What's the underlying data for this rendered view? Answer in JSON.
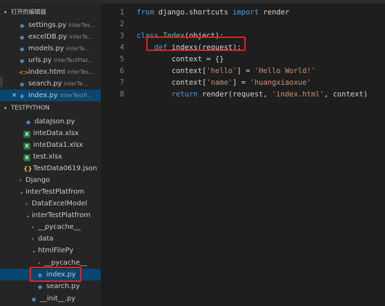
{
  "explorer": {
    "open_editors": {
      "title": "打开的编辑器",
      "items": [
        {
          "name": "settings.py",
          "desc": "interTes...",
          "icon": "python-file-icon"
        },
        {
          "name": "excelDB.py",
          "desc": "interTe...",
          "icon": "python-file-icon"
        },
        {
          "name": "models.py",
          "desc": "interTe...",
          "icon": "python-file-icon"
        },
        {
          "name": "urls.py",
          "desc": "interTestPlat...",
          "icon": "python-file-icon"
        },
        {
          "name": "index.html",
          "desc": "interTes...",
          "icon": "html-file-icon"
        },
        {
          "name": "search.py",
          "desc": "interTe...",
          "icon": "python-file-icon"
        },
        {
          "name": "index.py",
          "desc": "interTestP...",
          "icon": "python-file-icon",
          "selected": true
        }
      ]
    },
    "workspace": {
      "title": "TESTPYTHON",
      "items": [
        {
          "name": "dataJson.py",
          "icon": "python-file-icon"
        },
        {
          "name": "inteData.xlsx",
          "icon": "excel-file-icon"
        },
        {
          "name": "inteData1.xlsx",
          "icon": "excel-file-icon"
        },
        {
          "name": "test.xlsx",
          "icon": "excel-file-icon"
        },
        {
          "name": "TestData0619.json",
          "icon": "json-file-icon"
        },
        {
          "name": "Django",
          "icon": "folder-collapsed"
        },
        {
          "name": "interTestPlatfrom",
          "icon": "folder-expanded"
        },
        {
          "name": "DataExcelModel",
          "icon": "folder-collapsed"
        },
        {
          "name": "interTestPlatfrom",
          "icon": "folder-expanded"
        },
        {
          "name": "__pycache__",
          "icon": "folder-collapsed"
        },
        {
          "name": "data",
          "icon": "folder-collapsed"
        },
        {
          "name": "htmlFilePy",
          "icon": "folder-expanded"
        },
        {
          "name": "__pycache__",
          "icon": "folder-collapsed"
        },
        {
          "name": "index.py",
          "icon": "python-file-icon",
          "selected": true
        },
        {
          "name": "search.py",
          "icon": "python-file-icon"
        },
        {
          "name": "__init__.py",
          "icon": "python-file-icon"
        }
      ]
    }
  },
  "editor": {
    "line_numbers": [
      "1",
      "2",
      "3",
      "4",
      "5",
      "6",
      "7",
      "8"
    ],
    "code": {
      "l1_from": "from",
      "l1_mod": " django.shortcuts ",
      "l1_import": "import",
      "l1_name": " render",
      "l3_class": "class",
      "l3_name": "Index",
      "l3_paren": "(object):",
      "l4_def": "def",
      "l4_name": " indexs(request):",
      "l5": "        context = {}",
      "l6_pre": "        context[",
      "l6_key": "'hello'",
      "l6_mid": "] = ",
      "l6_val": "'Hello World!'",
      "l7_pre": "        context[",
      "l7_key": "'name'",
      "l7_mid": "] = ",
      "l7_val": "'huangxiaoxue'",
      "l8_return": "return",
      "l8_pre": " render(request, ",
      "l8_str": "'index.html'",
      "l8_post": ", context)"
    }
  },
  "colors": {
    "highlight": "#e0261c",
    "selection": "#094771"
  }
}
